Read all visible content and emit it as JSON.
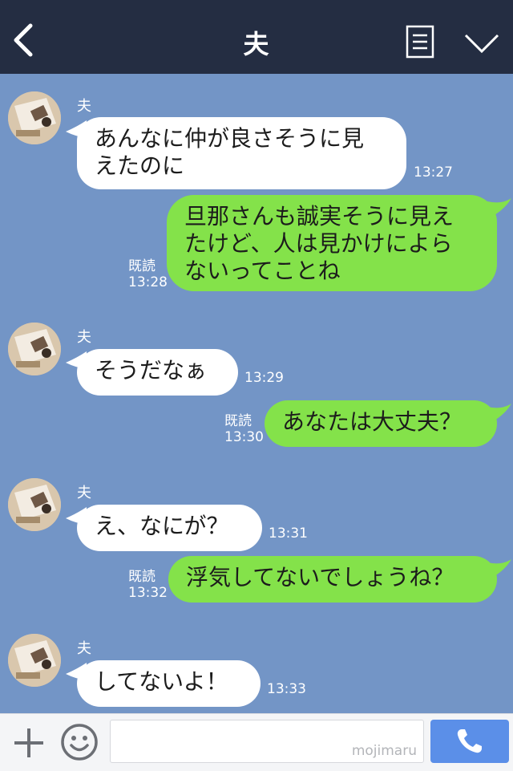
{
  "header": {
    "title": "夫"
  },
  "messages": [
    {
      "sender": "夫",
      "text_lines": [
        "あんなに仲が良さそうに見",
        "えたのに"
      ],
      "time": "13:27"
    },
    {
      "text_lines": [
        "旦那さんも誠実そうに見え",
        "たけど、人は見かけによら",
        "ないってことね"
      ],
      "read": "既読",
      "time": "13:28"
    },
    {
      "sender": "夫",
      "text": "そうだなぁ",
      "time": "13:29"
    },
    {
      "text": "あなたは大丈夫？",
      "read": "既読",
      "time": "13:30"
    },
    {
      "sender": "夫",
      "text": "え、なにが？",
      "time": "13:31"
    },
    {
      "text": "浮気してないでしょうね？",
      "read": "既読",
      "time": "13:32"
    },
    {
      "sender": "夫",
      "text": "してないよ！",
      "time": "13:33"
    }
  ],
  "input": {
    "placeholder": "",
    "watermark": "mojimaru"
  },
  "colors": {
    "header_bg": "#242d42",
    "chat_bg": "#7395c6",
    "bubble_left": "#ffffff",
    "bubble_right": "#84e24a",
    "call_button": "#5b8fe8"
  },
  "icons": [
    "back-arrow-icon",
    "menu-icon",
    "chevron-down-icon",
    "plus-icon",
    "smiley-icon",
    "phone-icon"
  ]
}
